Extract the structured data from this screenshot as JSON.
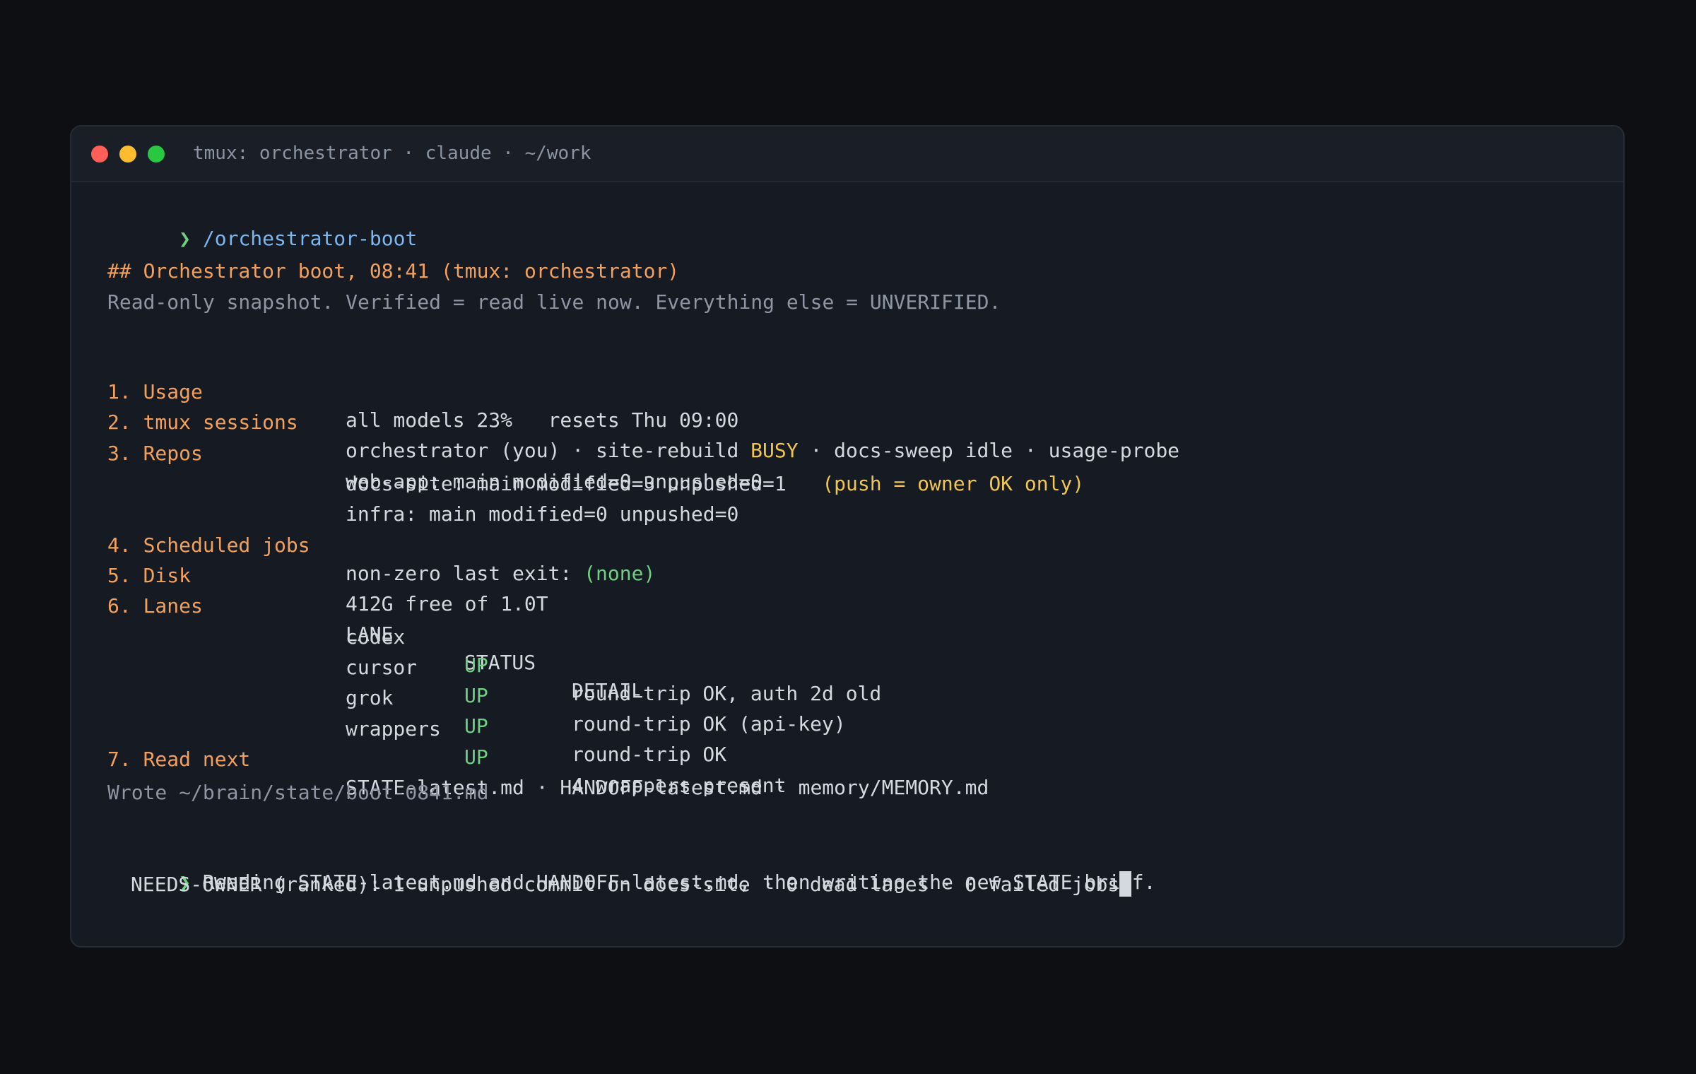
{
  "window": {
    "title": "tmux: orchestrator · claude · ~/work"
  },
  "prompt_symbol": "❯",
  "command": "/orchestrator-boot",
  "header": "## Orchestrator boot, 08:41 (tmux: orchestrator)",
  "subheader": "Read-only snapshot. Verified = read live now. Everything else = UNVERIFIED.",
  "sections": {
    "usage": {
      "label": "1. Usage",
      "value": "all models 23%   resets Thu 09:00"
    },
    "tmux": {
      "label": "2. tmux sessions",
      "prefix": "orchestrator (you) · site-rebuild ",
      "busy": "BUSY",
      "suffix": " · docs-sweep idle · usage-probe"
    },
    "repos": {
      "label": "3. Repos",
      "lines": [
        "web-app: main modified=0 unpushed=0",
        "docs-site: main modified=3 unpushed=1",
        "infra: main modified=0 unpushed=0"
      ],
      "note": "(push = owner OK only)"
    },
    "jobs": {
      "label": "4. Scheduled jobs",
      "prefix": "non-zero last exit: ",
      "value": "(none)"
    },
    "disk": {
      "label": "5. Disk",
      "value": "412G free of 1.0T"
    },
    "lanes": {
      "label": "6. Lanes",
      "columns": [
        "LANE",
        "STATUS",
        "DETAIL"
      ],
      "rows": [
        {
          "lane": "codex",
          "status": "UP",
          "detail": "round-trip OK, auth 2d old"
        },
        {
          "lane": "cursor",
          "status": "UP",
          "detail": "round-trip OK (api-key)"
        },
        {
          "lane": "grok",
          "status": "UP",
          "detail": "round-trip OK"
        },
        {
          "lane": "wrappers",
          "status": "UP",
          "detail": "4 wrappers present"
        }
      ]
    },
    "read_next": {
      "label": "7. Read next",
      "value": "STATE-latest.md · HANDOFF-latest.md · memory/MEMORY.md"
    }
  },
  "wrote": "Wrote ~/brain/state/boot-0841.md",
  "response": {
    "line1": "Reading STATE-latest.md and HANDOFF-latest.md, then writing the new STATE brief.",
    "line2": "NEEDS-OWNER (ranked): 1 unpushed commit on docs-site · 0 dead lanes · 0 failed jobs"
  },
  "colors": {
    "orange": "#f3a05c",
    "blue": "#7cb7f2",
    "green": "#6fd082",
    "yellow": "#f0c552",
    "gray": "#8e96a3"
  }
}
